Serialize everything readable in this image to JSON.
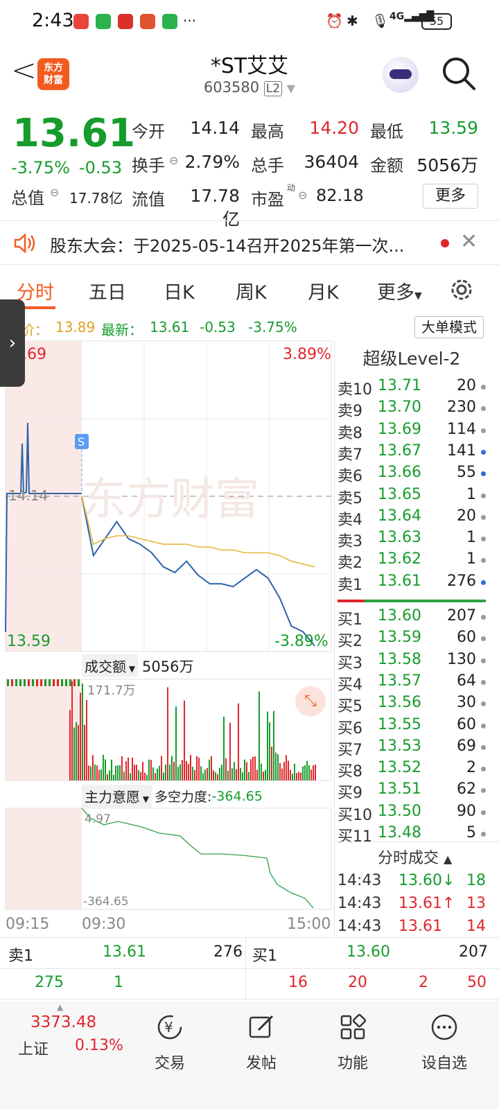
{
  "status": {
    "time": "2:43",
    "battery": "55"
  },
  "header": {
    "back": "<",
    "logo_line1": "东方",
    "logo_line2": "财富",
    "title": "*ST艾艾",
    "code": "603580",
    "code_badge": "L2"
  },
  "quote": {
    "price": "13.61",
    "change_pct": "-3.75%",
    "change": "-0.53",
    "open_label": "今开",
    "open": "14.14",
    "high_label": "最高",
    "high": "14.20",
    "low_label": "最低",
    "low": "13.59",
    "turnover_label": "换手",
    "turnover": "2.79%",
    "volume_label": "总手",
    "volume": "36404",
    "amount_label": "金额",
    "amount": "5056万",
    "mktcap_label": "总值",
    "mktcap": "17.78亿",
    "float_label": "流值",
    "float": "17.78亿",
    "pe_label": "市盈",
    "pe_sup": "动",
    "pe": "82.18",
    "more": "更多"
  },
  "notice": {
    "text": "股东大会：于2025-05-14召开2025年第一次..."
  },
  "tabs": [
    {
      "label": "分时",
      "active": true
    },
    {
      "label": "五日"
    },
    {
      "label": "日K"
    },
    {
      "label": "周K"
    },
    {
      "label": "月K"
    },
    {
      "label": "更多"
    }
  ],
  "infoline": {
    "avg_label": "价：",
    "avg": "13.89",
    "latest_label": "最新：",
    "latest": "13.61",
    "chg": "-0.53",
    "chg_pct": "-3.75%",
    "bigmode": "大单模式"
  },
  "chart": {
    "top_left": ".69",
    "top_right": "3.89%",
    "prev_close": "14.14",
    "bottom_left": "13.59",
    "bottom_right": "-3.89%",
    "watermark": "东方财富",
    "s_marker": "S",
    "vol_selector": "成交额",
    "vol_total": "5056万",
    "vol_max": "171.7万",
    "ind_selector": "主力意愿",
    "ind_label": "多空力度:",
    "ind_value": "-364.65",
    "ind_top": "4.97",
    "ind_bottom": "-364.65",
    "time_start": "09:15",
    "time_open": "09:30",
    "time_end": "15:00"
  },
  "chart_data": {
    "type": "line",
    "title": "",
    "ylim": [
      13.59,
      14.69
    ],
    "reference": 14.14,
    "series": [
      {
        "x": [
          "09:30",
          "09:35",
          "09:40",
          "09:45",
          "09:50",
          "10:00",
          "10:10",
          "10:20",
          "10:30",
          "10:45",
          "11:00",
          "11:15",
          "11:30",
          "13:15",
          "13:30",
          "13:45",
          "14:00",
          "14:15",
          "14:30",
          "14:45",
          "14:55"
        ],
        "values": [
          14.14,
          13.93,
          13.99,
          14.05,
          13.99,
          13.97,
          13.94,
          13.89,
          13.87,
          13.91,
          13.86,
          13.83,
          13.83,
          13.82,
          13.85,
          13.88,
          13.85,
          13.78,
          13.68,
          13.66,
          13.61
        ]
      },
      {
        "values": [
          14.14,
          13.97,
          13.99,
          14.0,
          14.0,
          13.99,
          13.98,
          13.97,
          13.97,
          13.97,
          13.96,
          13.96,
          13.95,
          13.95,
          13.94,
          13.94,
          13.94,
          13.93,
          13.91,
          13.9,
          13.89
        ]
      }
    ]
  },
  "level2": {
    "title": "超级Level-2",
    "asks": [
      {
        "label": "卖10",
        "price": "13.71",
        "vol": "20",
        "dot": "gray"
      },
      {
        "label": "卖9",
        "price": "13.70",
        "vol": "230",
        "dot": "gray"
      },
      {
        "label": "卖8",
        "price": "13.69",
        "vol": "114",
        "dot": "gray"
      },
      {
        "label": "卖7",
        "price": "13.67",
        "vol": "141",
        "dot": "blue"
      },
      {
        "label": "卖6",
        "price": "13.66",
        "vol": "55",
        "dot": "blue"
      },
      {
        "label": "卖5",
        "price": "13.65",
        "vol": "1",
        "dot": "gray"
      },
      {
        "label": "卖4",
        "price": "13.64",
        "vol": "20",
        "dot": "gray"
      },
      {
        "label": "卖3",
        "price": "13.63",
        "vol": "1",
        "dot": "gray"
      },
      {
        "label": "卖2",
        "price": "13.62",
        "vol": "1",
        "dot": "gray"
      },
      {
        "label": "卖1",
        "price": "13.61",
        "vol": "276",
        "dot": "blue"
      }
    ],
    "bids": [
      {
        "label": "买1",
        "price": "13.60",
        "vol": "207",
        "dot": "gray"
      },
      {
        "label": "买2",
        "price": "13.59",
        "vol": "60",
        "dot": "gray"
      },
      {
        "label": "买3",
        "price": "13.58",
        "vol": "130",
        "dot": "gray"
      },
      {
        "label": "买4",
        "price": "13.57",
        "vol": "64",
        "dot": "gray"
      },
      {
        "label": "买5",
        "price": "13.56",
        "vol": "30",
        "dot": "gray"
      },
      {
        "label": "买6",
        "price": "13.55",
        "vol": "60",
        "dot": "gray"
      },
      {
        "label": "买7",
        "price": "13.53",
        "vol": "69",
        "dot": "gray"
      },
      {
        "label": "买8",
        "price": "13.52",
        "vol": "2",
        "dot": "gray"
      },
      {
        "label": "买9",
        "price": "13.51",
        "vol": "62",
        "dot": "gray"
      },
      {
        "label": "买10",
        "price": "13.50",
        "vol": "90",
        "dot": "gray"
      },
      {
        "label": "买11",
        "price": "13.48",
        "vol": "5",
        "dot": "gray"
      }
    ],
    "ticks_title": "分时成交",
    "ticks": [
      {
        "time": "14:43",
        "price": "13.60↓",
        "vol": "18",
        "color": "green"
      },
      {
        "time": "14:43",
        "price": "13.61↑",
        "vol": "13",
        "color": "red"
      },
      {
        "time": "14:43",
        "price": "13.61",
        "vol": "14",
        "color": "red"
      }
    ]
  },
  "bottom_quote": {
    "ask_label": "卖1",
    "ask_price": "13.61",
    "ask_vol": "276",
    "bid_label": "买1",
    "bid_price": "13.60",
    "bid_vol": "207",
    "ask_split": [
      "275",
      "1"
    ],
    "bid_split": [
      "16",
      "20",
      "2",
      "50"
    ]
  },
  "nav": {
    "index_value": "3373.48",
    "index_name": "上证",
    "index_pct": "0.13%",
    "items": [
      {
        "label": "交易",
        "icon": "yen-icon"
      },
      {
        "label": "发帖",
        "icon": "edit-icon"
      },
      {
        "label": "功能",
        "icon": "grid-icon"
      },
      {
        "label": "设自选",
        "icon": "more-icon"
      }
    ]
  },
  "colors": {
    "accent": "#f25c21",
    "up": "#e0262b",
    "down": "#169c2c",
    "price_line": "#2c63a8",
    "avg_line": "#e8b83c"
  }
}
